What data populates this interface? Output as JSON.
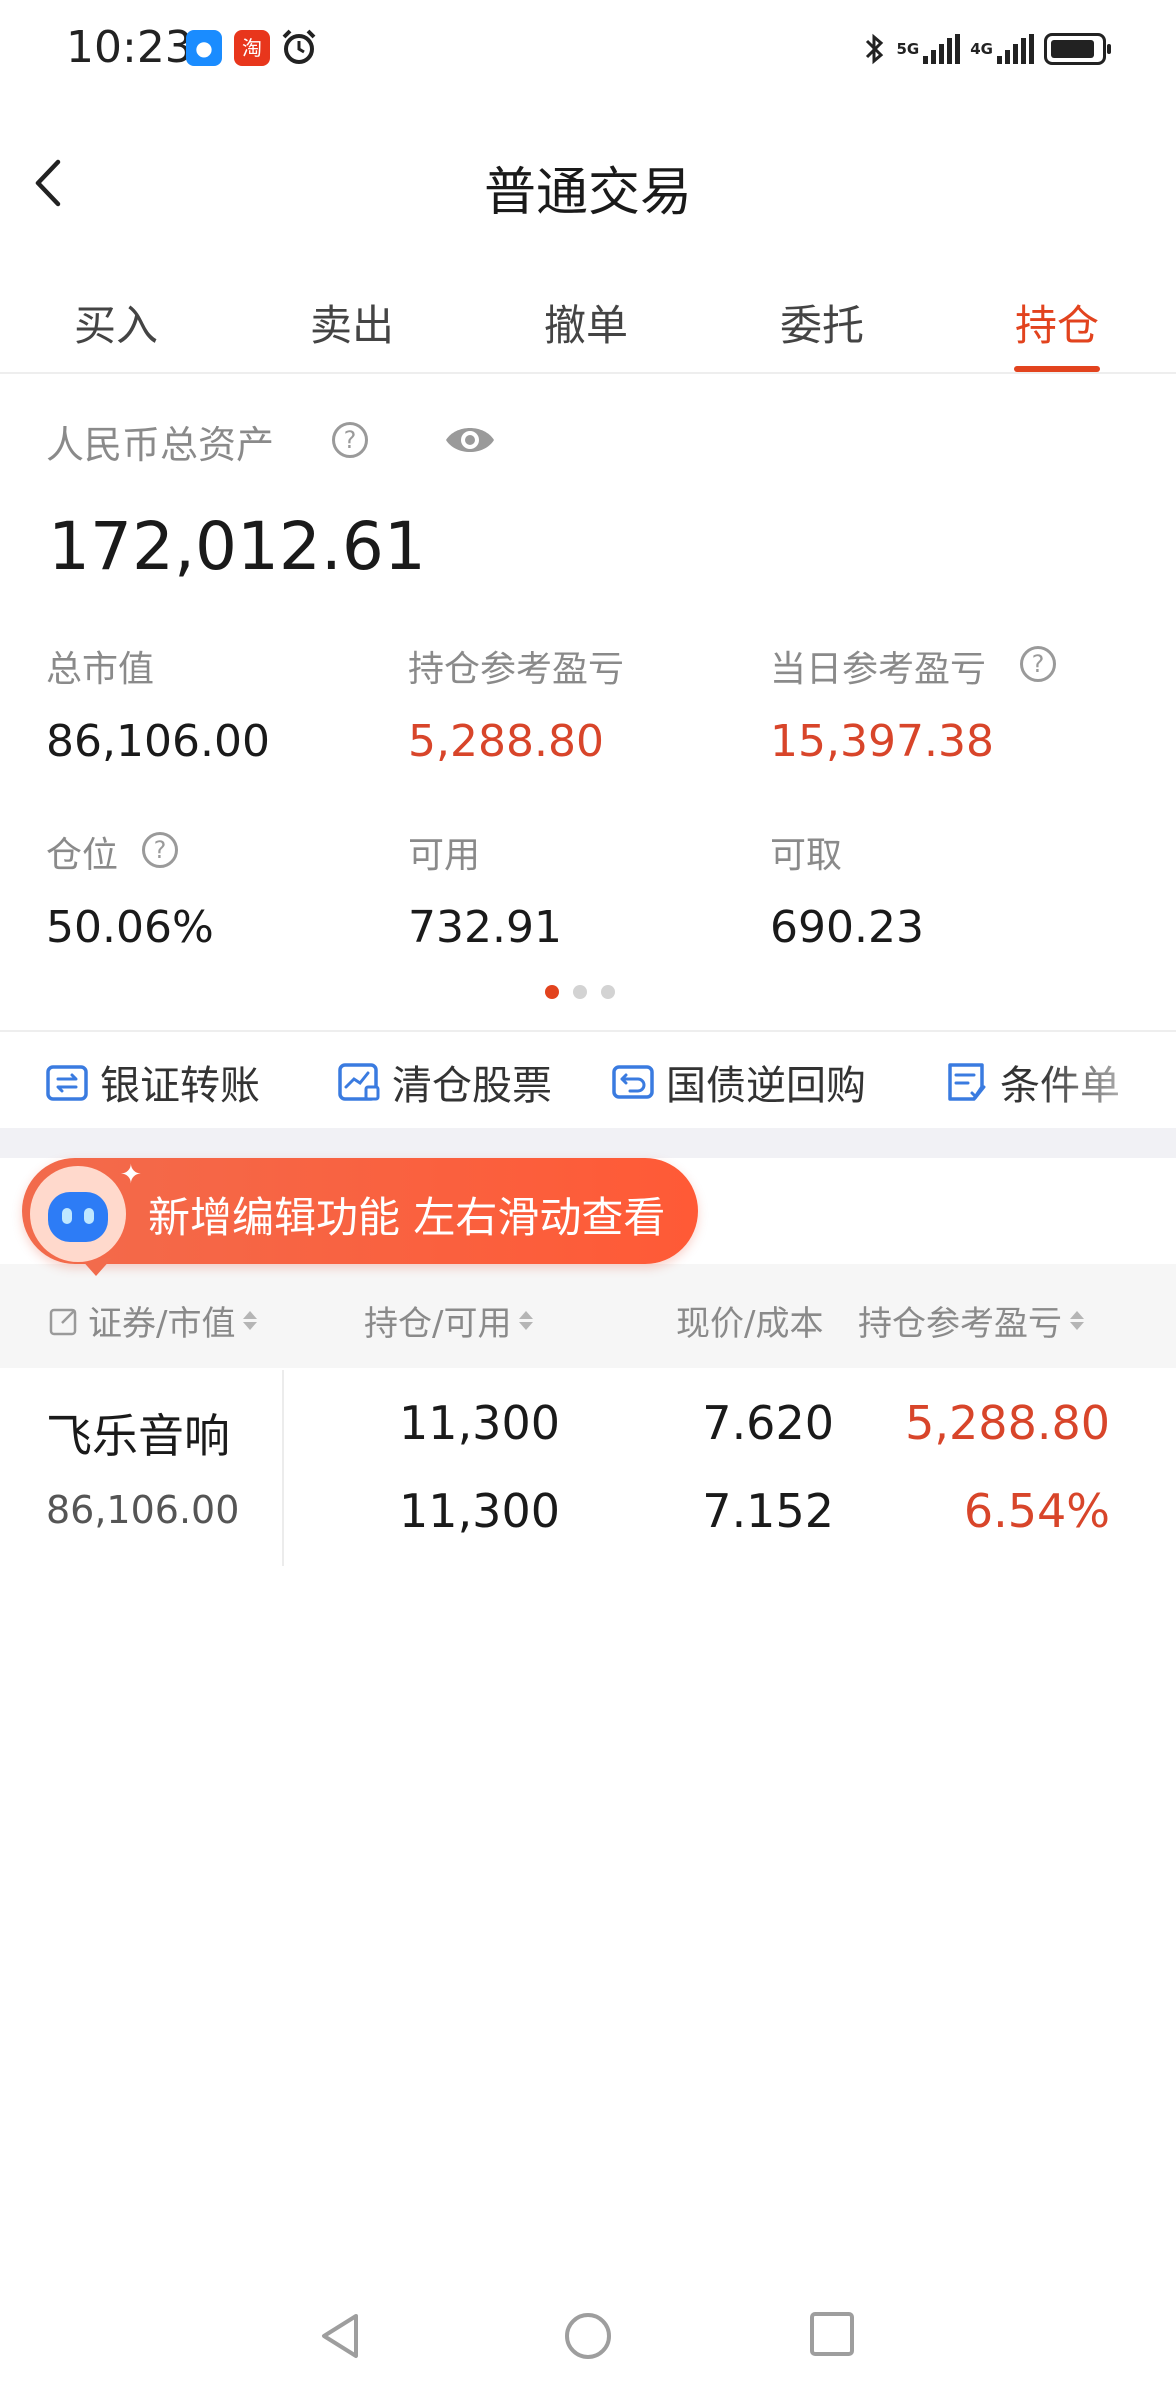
{
  "status_bar": {
    "time": "10:23",
    "app_icons": [
      "message-app-icon",
      "taobao-app-icon",
      "alarm-icon"
    ],
    "network_1": "5G",
    "network_2": "4G",
    "battery_level": 0.85
  },
  "header": {
    "title": "普通交易",
    "back_icon": "chevron-left-icon"
  },
  "tabs": [
    {
      "label": "买入",
      "active": false
    },
    {
      "label": "卖出",
      "active": false
    },
    {
      "label": "撤单",
      "active": false
    },
    {
      "label": "委托",
      "active": false
    },
    {
      "label": "持仓",
      "active": true
    }
  ],
  "assets": {
    "total_label": "人民币总资产",
    "total_value": "172,012.61",
    "stats": [
      {
        "label": "总市值",
        "value": "86,106.00",
        "color": "#1a1a1a"
      },
      {
        "label": "持仓参考盈亏",
        "value": "5,288.80",
        "color": "#d8452a"
      },
      {
        "label": "当日参考盈亏",
        "value": "15,397.38",
        "color": "#d8452a"
      },
      {
        "label": "仓位",
        "value": "50.06%",
        "color": "#1a1a1a"
      },
      {
        "label": "可用",
        "value": "732.91",
        "color": "#1a1a1a"
      },
      {
        "label": "可取",
        "value": "690.23",
        "color": "#1a1a1a"
      }
    ],
    "page_dots": {
      "count": 3,
      "active_index": 0
    }
  },
  "quick_actions": [
    {
      "label": "银证转账",
      "icon": "bank-transfer-icon"
    },
    {
      "label": "清仓股票",
      "icon": "clear-position-icon"
    },
    {
      "label": "国债逆回购",
      "icon": "reverse-repo-icon"
    },
    {
      "label": "条件单",
      "icon": "conditional-order-icon"
    }
  ],
  "promo": {
    "text": "新增编辑功能 左右滑动查看"
  },
  "table": {
    "headers": [
      "证券/市值",
      "持仓/可用",
      "现价/成本",
      "持仓参考盈亏"
    ],
    "rows": [
      {
        "name": "飞乐音响",
        "market_value": "86,106.00",
        "position": "11,300",
        "available": "11,300",
        "price": "7.620",
        "cost": "7.152",
        "pnl": "5,288.80",
        "pnl_pct": "6.54%"
      }
    ]
  },
  "colors": {
    "accent": "#e2431e",
    "profit": "#d8452a"
  }
}
